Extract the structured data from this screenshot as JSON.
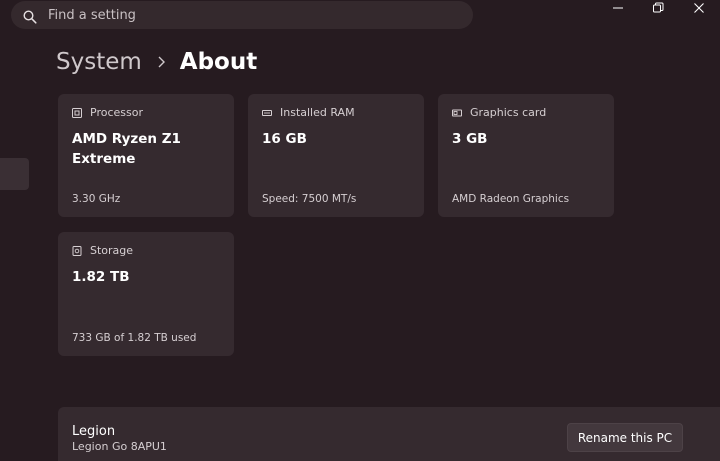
{
  "search": {
    "placeholder": "Find a setting",
    "icon": "search-icon"
  },
  "window_controls": {
    "minimize_icon": "minimize-icon",
    "maximize_icon": "restore-icon",
    "close_icon": "close-icon"
  },
  "breadcrumb": {
    "parent": "System",
    "separator_icon": "chevron-right-icon",
    "current": "About"
  },
  "specs": [
    {
      "icon": "processor-icon",
      "label": "Processor",
      "value": "AMD Ryzen Z1 Extreme",
      "detail": "3.30 GHz"
    },
    {
      "icon": "ram-icon",
      "label": "Installed RAM",
      "value": "16 GB",
      "detail": "Speed: 7500 MT/s"
    },
    {
      "icon": "graphics-card-icon",
      "label": "Graphics card",
      "value": "3 GB",
      "detail": "AMD Radeon Graphics"
    },
    {
      "icon": "storage-icon",
      "label": "Storage",
      "value": "1.82 TB",
      "detail": "733 GB of 1.82 TB used"
    }
  ],
  "device": {
    "name": "Legion",
    "model": "Legion Go 8APU1",
    "rename_label": "Rename this PC"
  },
  "colors": {
    "background": "#261b20",
    "card": "#352a2f",
    "search": "#34292d",
    "button": "#43383d"
  }
}
